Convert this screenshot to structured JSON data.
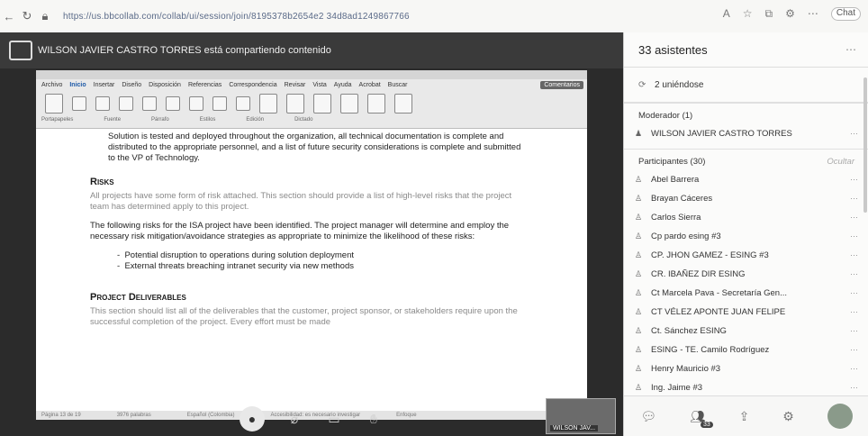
{
  "browser": {
    "url": "https://us.bbcollab.com/collab/ui/session/join/8195378b2654e2 34d8ad1249867766",
    "profile_label": "Chat"
  },
  "share": {
    "banner": "WILSON JAVIER CASTRO TORRES está compartiendo contenido"
  },
  "doc": {
    "tabs": [
      "Archivo",
      "Inicio",
      "Insertar",
      "Diseño",
      "Disposición",
      "Referencias",
      "Correspondencia",
      "Revisar",
      "Vista",
      "Ayuda",
      "Acrobat",
      "Buscar"
    ],
    "active_tab": "Inicio",
    "comments_btn": "Comentarios",
    "group_labels": [
      "Portapapeles",
      "Fuente",
      "Párrafo",
      "Estilos",
      "Edición",
      "Dictado"
    ],
    "intro_text": "Solution is tested and deployed throughout the organization, all technical documentation is complete and distributed to the appropriate personnel, and a list of future security considerations is complete and submitted to the VP of Technology.",
    "risks_heading": "Risks",
    "risks_gray": "All projects have some form of risk attached.  This section should provide a list of high-level risks that the project team has determined apply to this project.",
    "risks_body": "The following risks for the ISA project have been identified.  The project manager will determine and employ the necessary risk mitigation/avoidance strategies as appropriate to minimize the likelihood of these risks:",
    "bullets": [
      "Potential disruption to operations during solution deployment",
      "External threats breaching intranet security via new methods"
    ],
    "deliverables_heading": "Project Deliverables",
    "deliverables_gray": "This section should list all of the deliverables that the customer, project sponsor, or stakeholders require upon the successful completion of the project.  Every effort must be made",
    "footer_items": [
      "Página 13 de 19",
      "3976 palabras",
      "Español (Colombia)",
      "Accesibilidad: es necesario investigar",
      "Enfoque"
    ]
  },
  "presenter_thumb": "WILSON JAV...",
  "panel": {
    "title": "33 asistentes",
    "joining": "2 uniéndose",
    "moderator_section": "Moderador (1)",
    "moderator": "WILSON JAVIER CASTRO TORRES",
    "participants_section": "Participantes (30)",
    "participants_aside": "Ocultar",
    "participants": [
      "Abel Barrera",
      "Brayan Cáceres",
      "Carlos Sierra",
      "Cp pardo esing #3",
      "CP. JHON GAMEZ - ESING #3",
      "CR. IBAÑEZ DIR ESING",
      "Ct Marcela Pava - Secretaría Gen...",
      "CT VÉLEZ APONTE JUAN FELIPE",
      "Ct. Sánchez ESING",
      "ESING - TE. Camilo Rodríguez",
      "Henry Mauricio #3",
      "Ing. Jaime #3"
    ],
    "footer_badge": "33"
  }
}
